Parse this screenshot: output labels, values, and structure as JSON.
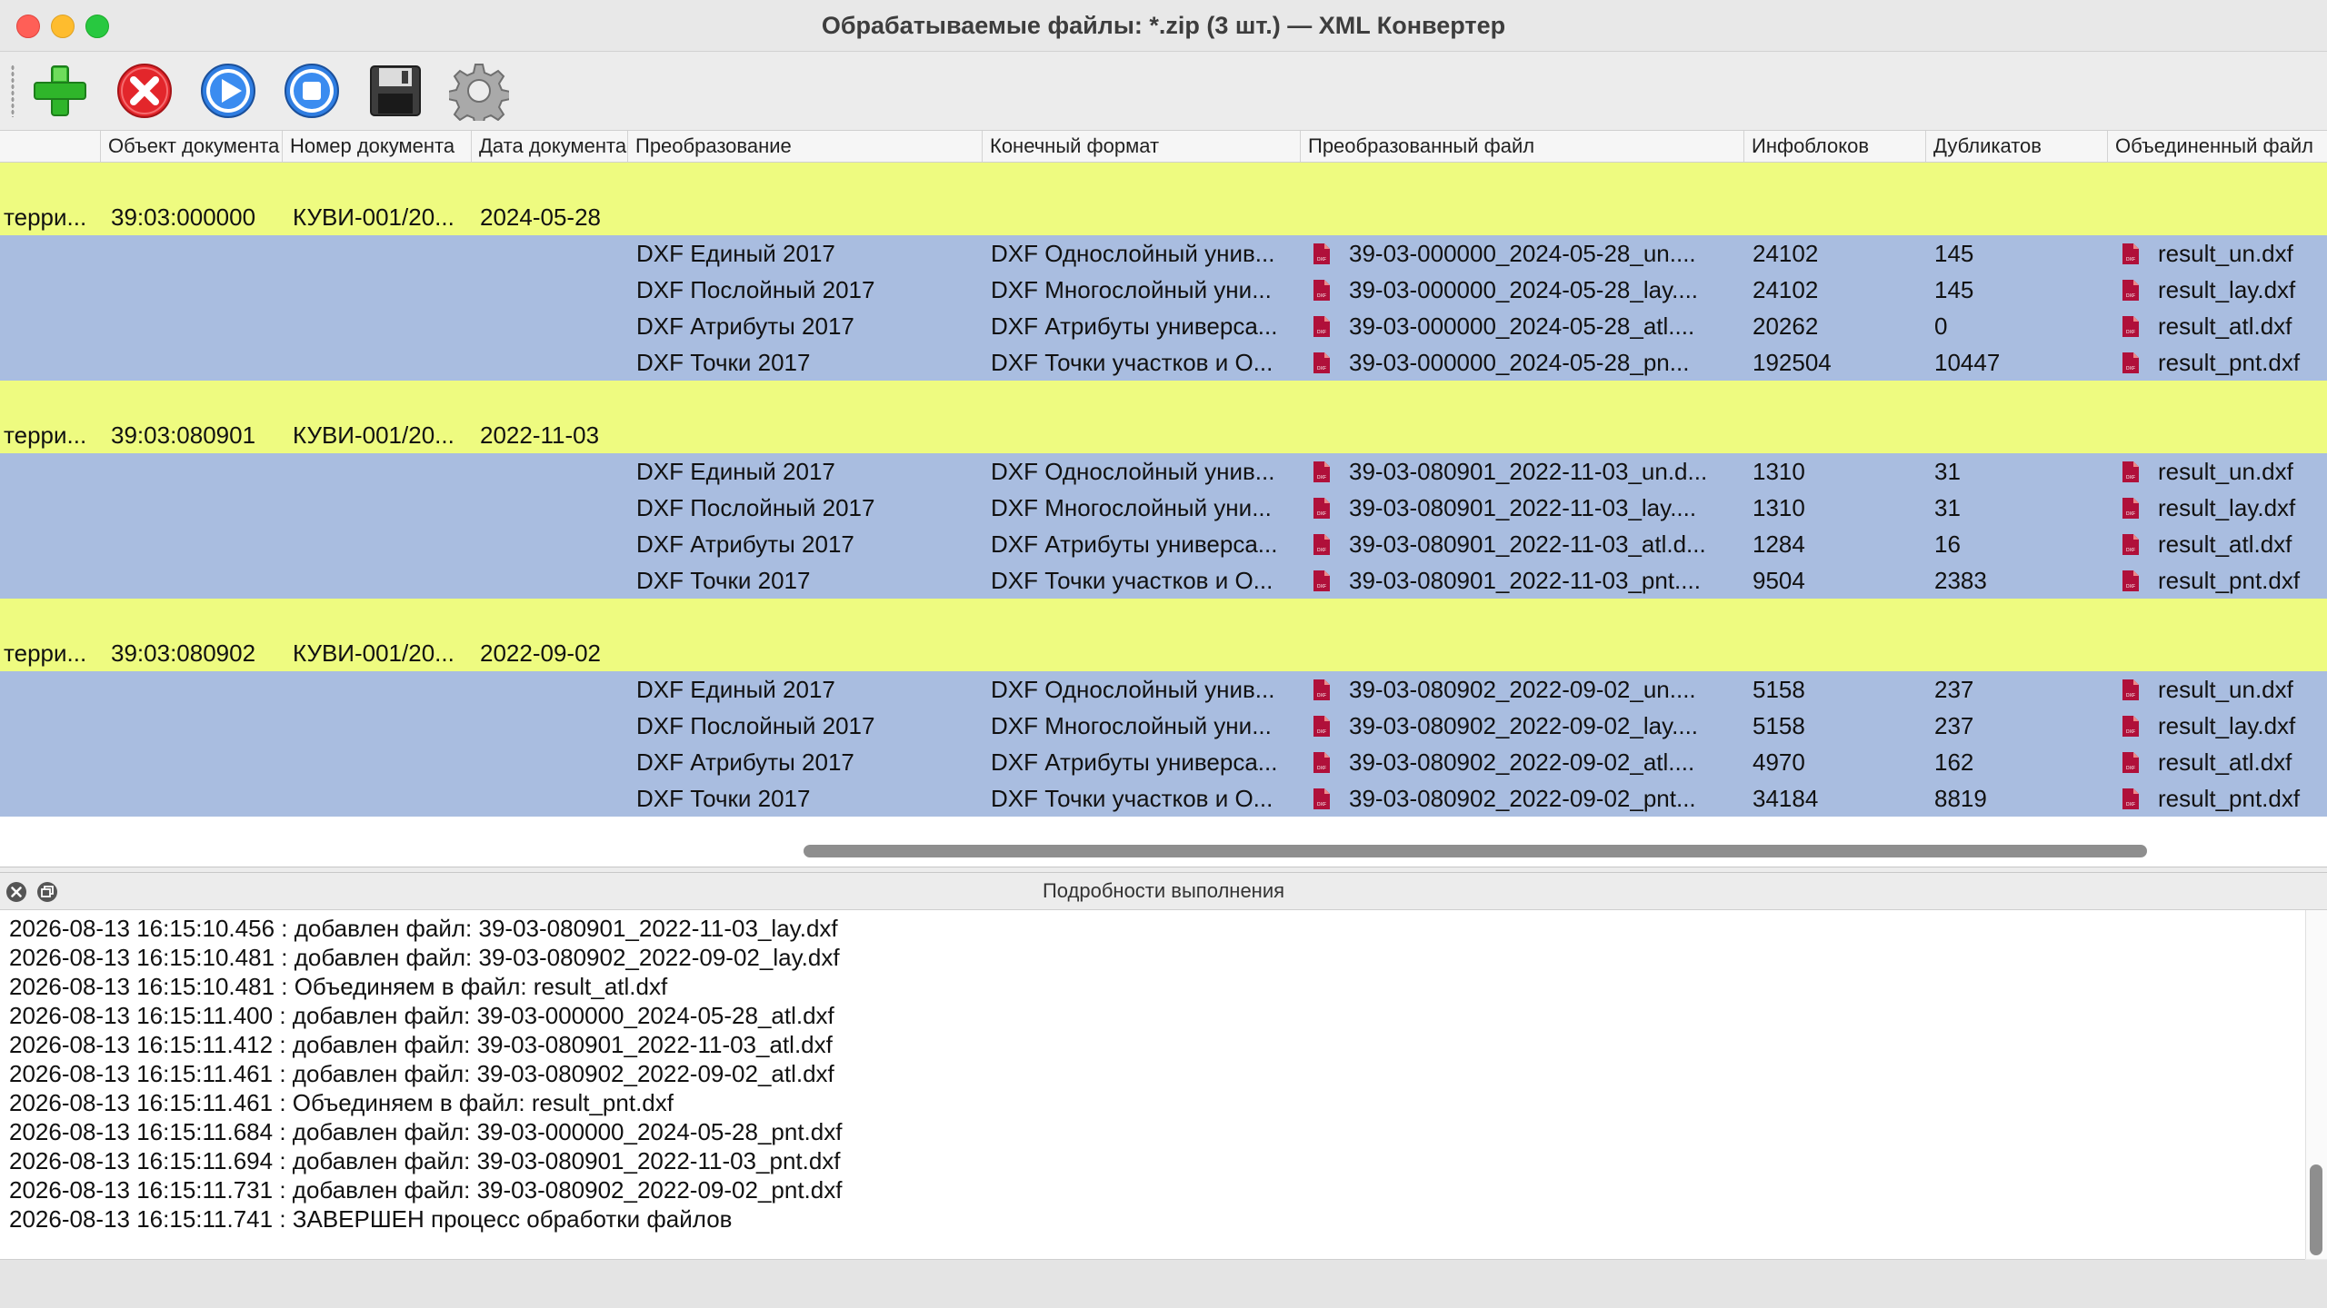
{
  "window": {
    "title": "Обрабатываемые файлы: *.zip (3 шт.) — XML Конвертер"
  },
  "toolbar": {
    "add": {
      "icon": "add-icon"
    },
    "remove": {
      "icon": "remove-icon"
    },
    "run": {
      "icon": "play-icon"
    },
    "stop": {
      "icon": "stop-icon"
    },
    "save": {
      "icon": "save-icon"
    },
    "settings": {
      "icon": "gear-icon"
    }
  },
  "table": {
    "columns": [
      "",
      "Объект документа",
      "Номер документа",
      "Дата документа",
      "Преобразование",
      "Конечный формат",
      "Преобразованный файл",
      "Инфоблоков",
      "Дубликатов",
      "Объединенный файл"
    ],
    "groups": [
      {
        "kind": "терри...",
        "object": "39:03:000000",
        "number": "КУВИ-001/20...",
        "date": "2024-05-28",
        "rows": [
          {
            "conversion": "DXF Единый 2017",
            "format": "DXF Однослойный унив...",
            "file": "39-03-000000_2024-05-28_un....",
            "blocks": "24102",
            "dups": "145",
            "merged": "result_un.dxf"
          },
          {
            "conversion": "DXF Послойный 2017",
            "format": "DXF Многослойный уни...",
            "file": "39-03-000000_2024-05-28_lay....",
            "blocks": "24102",
            "dups": "145",
            "merged": "result_lay.dxf"
          },
          {
            "conversion": "DXF Атрибуты 2017",
            "format": "DXF Атрибуты универса...",
            "file": "39-03-000000_2024-05-28_atl....",
            "blocks": "20262",
            "dups": "0",
            "merged": "result_atl.dxf"
          },
          {
            "conversion": "DXF Точки 2017",
            "format": "DXF Точки участков и О...",
            "file": "39-03-000000_2024-05-28_pn...",
            "blocks": "192504",
            "dups": "10447",
            "merged": "result_pnt.dxf"
          }
        ]
      },
      {
        "kind": "терри...",
        "object": "39:03:080901",
        "number": "КУВИ-001/20...",
        "date": "2022-11-03",
        "rows": [
          {
            "conversion": "DXF Единый 2017",
            "format": "DXF Однослойный унив...",
            "file": "39-03-080901_2022-11-03_un.d...",
            "blocks": "1310",
            "dups": "31",
            "merged": "result_un.dxf"
          },
          {
            "conversion": "DXF Послойный 2017",
            "format": "DXF Многослойный уни...",
            "file": "39-03-080901_2022-11-03_lay....",
            "blocks": "1310",
            "dups": "31",
            "merged": "result_lay.dxf"
          },
          {
            "conversion": "DXF Атрибуты 2017",
            "format": "DXF Атрибуты универса...",
            "file": "39-03-080901_2022-11-03_atl.d...",
            "blocks": "1284",
            "dups": "16",
            "merged": "result_atl.dxf"
          },
          {
            "conversion": "DXF Точки 2017",
            "format": "DXF Точки участков и О...",
            "file": "39-03-080901_2022-11-03_pnt....",
            "blocks": "9504",
            "dups": "2383",
            "merged": "result_pnt.dxf"
          }
        ]
      },
      {
        "kind": "терри...",
        "object": "39:03:080902",
        "number": "КУВИ-001/20...",
        "date": "2022-09-02",
        "rows": [
          {
            "conversion": "DXF Единый 2017",
            "format": "DXF Однослойный унив...",
            "file": "39-03-080902_2022-09-02_un....",
            "blocks": "5158",
            "dups": "237",
            "merged": "result_un.dxf"
          },
          {
            "conversion": "DXF Послойный 2017",
            "format": "DXF Многослойный уни...",
            "file": "39-03-080902_2022-09-02_lay....",
            "blocks": "5158",
            "dups": "237",
            "merged": "result_lay.dxf"
          },
          {
            "conversion": "DXF Атрибуты 2017",
            "format": "DXF Атрибуты универса...",
            "file": "39-03-080902_2022-09-02_atl....",
            "blocks": "4970",
            "dups": "162",
            "merged": "result_atl.dxf"
          },
          {
            "conversion": "DXF Точки 2017",
            "format": "DXF Точки участков и О...",
            "file": "39-03-080902_2022-09-02_pnt...",
            "blocks": "34184",
            "dups": "8819",
            "merged": "result_pnt.dxf"
          }
        ]
      }
    ],
    "file_icon_label": "DXF"
  },
  "log_panel": {
    "title": "Подробности выполнения",
    "lines": [
      "2026-08-13 16:15:10.456 : добавлен файл: 39-03-080901_2022-11-03_lay.dxf",
      "2026-08-13 16:15:10.481 : добавлен файл: 39-03-080902_2022-09-02_lay.dxf",
      "2026-08-13 16:15:10.481 : Объединяем в файл: result_atl.dxf",
      "2026-08-13 16:15:11.400 : добавлен файл: 39-03-000000_2024-05-28_atl.dxf",
      "2026-08-13 16:15:11.412 : добавлен файл: 39-03-080901_2022-11-03_atl.dxf",
      "2026-08-13 16:15:11.461 : добавлен файл: 39-03-080902_2022-09-02_atl.dxf",
      "2026-08-13 16:15:11.461 : Объединяем в файл: result_pnt.dxf",
      "2026-08-13 16:15:11.684 : добавлен файл: 39-03-000000_2024-05-28_pnt.dxf",
      "2026-08-13 16:15:11.694 : добавлен файл: 39-03-080901_2022-11-03_pnt.dxf",
      "2026-08-13 16:15:11.731 : добавлен файл: 39-03-080902_2022-09-02_pnt.dxf",
      "2026-08-13 16:15:11.741 : ЗАВЕРШЕН процесс обработки файлов"
    ]
  },
  "colors": {
    "group_row": "#eefb80",
    "child_row": "#a9bde0",
    "file_icon": "#b0103a"
  }
}
